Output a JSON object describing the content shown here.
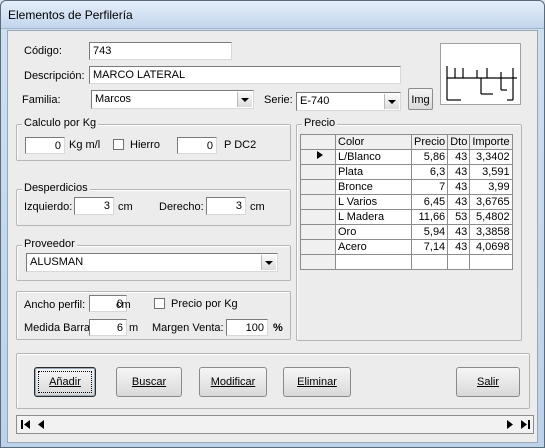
{
  "window": {
    "title": "Elementos de Perfilería"
  },
  "form": {
    "codigo_label": "Código:",
    "codigo_value": "743",
    "descripcion_label": "Descripción:",
    "descripcion_value": "MARCO LATERAL",
    "familia_label": "Familia:",
    "familia_value": "Marcos",
    "serie_label": "Serie:",
    "serie_value": "E-740",
    "img_button": "Img"
  },
  "calculo": {
    "title": "Calculo por Kg",
    "kg_value": "0",
    "kg_unit": "Kg m/l",
    "hierro_label": "Hierro",
    "pdc_value": "0",
    "pdc_label": "P DC2"
  },
  "desperdicios": {
    "title": "Desperdicios",
    "izquierdo_label": "Izquierdo:",
    "izquierdo_value": "3",
    "izquierdo_unit": "cm",
    "derecho_label": "Derecho:",
    "derecho_value": "3",
    "derecho_unit": "cm"
  },
  "proveedor": {
    "title": "Proveedor",
    "value": "ALUSMAN"
  },
  "medidas": {
    "ancho_label": "Ancho perfil:",
    "ancho_value": "0",
    "ancho_unit": "cm",
    "precio_kg_label": "Precio por Kg",
    "medida_label": "Medida Barra:",
    "medida_value": "6",
    "medida_unit": "m",
    "margen_label": "Margen Venta:",
    "margen_value": "100",
    "margen_unit": "%"
  },
  "precio": {
    "title": "Precio",
    "columns": [
      "Color",
      "Precio",
      "Dto",
      "Importe"
    ],
    "rows": [
      [
        "L/Blanco",
        "5,86",
        "43",
        "3,3402"
      ],
      [
        "Plata",
        "6,3",
        "43",
        "3,591"
      ],
      [
        "Bronce",
        "7",
        "43",
        "3,99"
      ],
      [
        "L Varios",
        "6,45",
        "43",
        "3,6765"
      ],
      [
        "L Madera",
        "11,66",
        "53",
        "5,4802"
      ],
      [
        "Oro",
        "5,94",
        "43",
        "3,3858"
      ],
      [
        "Acero",
        "7,14",
        "43",
        "4,0698"
      ]
    ]
  },
  "buttons": {
    "add": "Añadir",
    "search": "Buscar",
    "modify": "Modificar",
    "delete": "Eliminar",
    "exit": "Salir"
  }
}
